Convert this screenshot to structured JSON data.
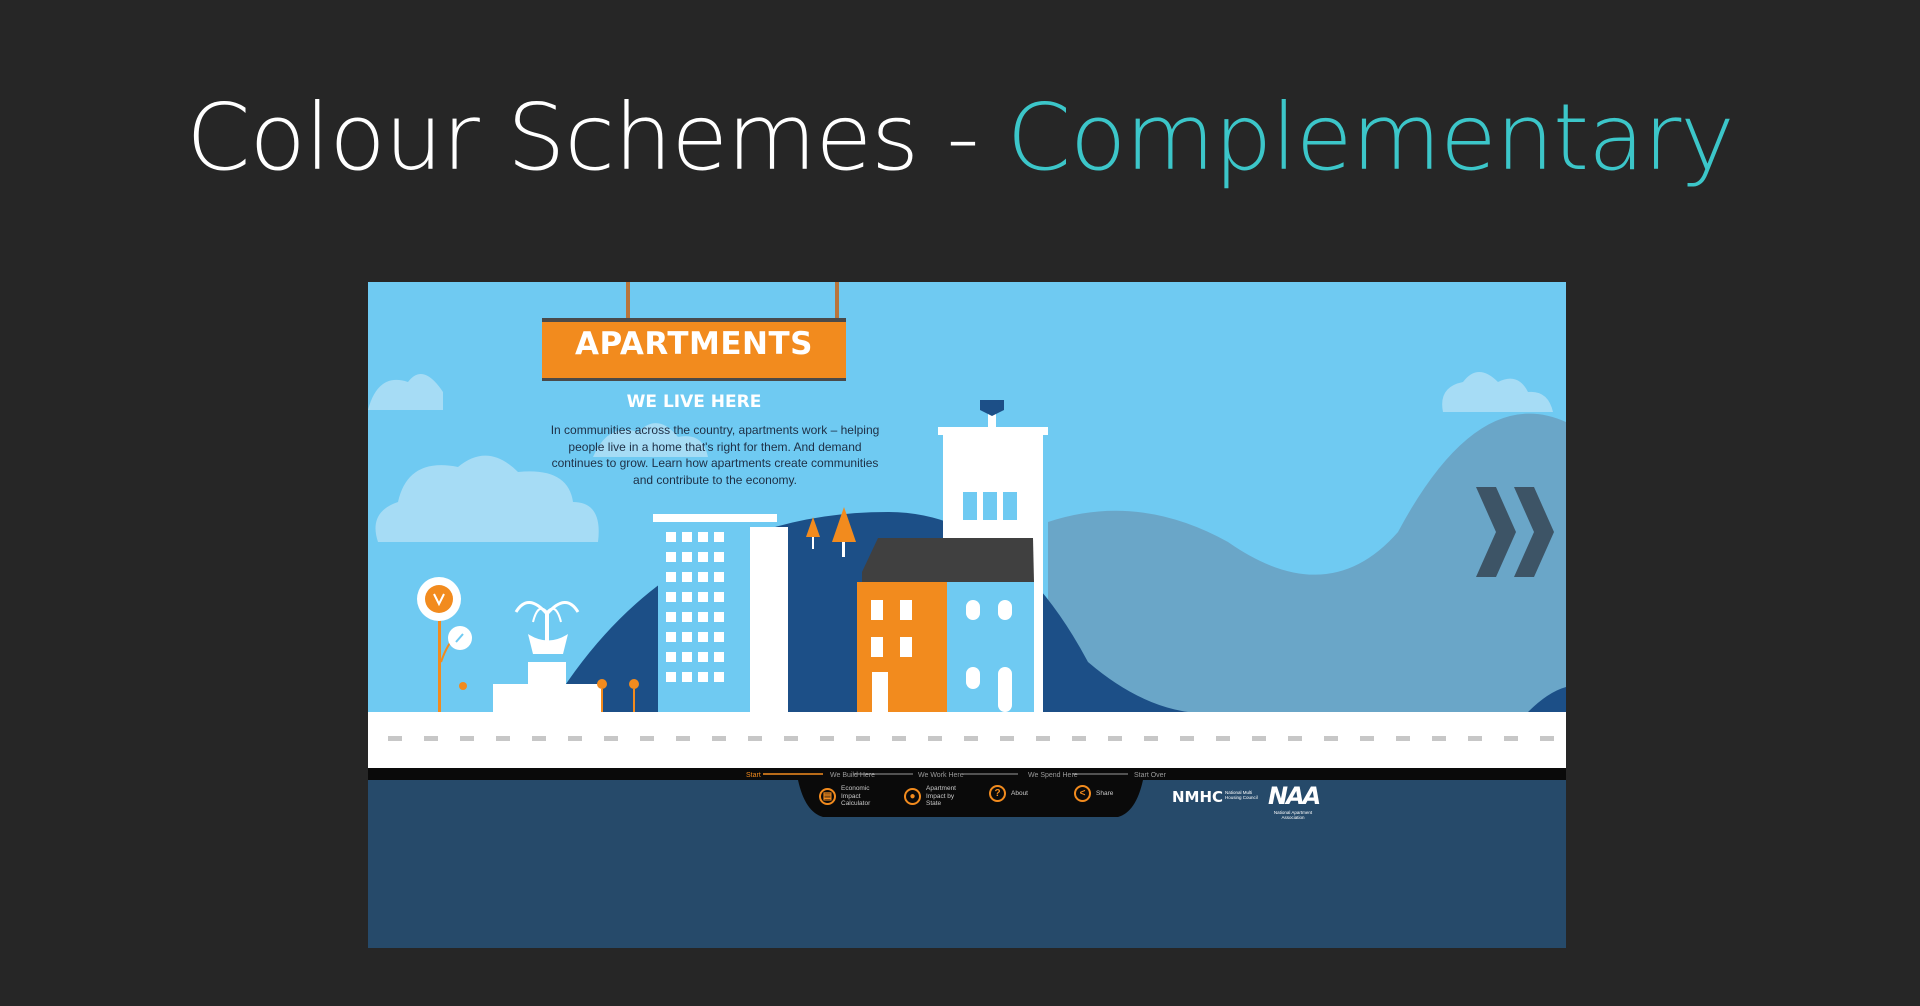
{
  "slide": {
    "title_main": "Colour Schemes - ",
    "title_accent": "Complementary",
    "accent_color": "#3cc6c9"
  },
  "apartments_site": {
    "sign_title": "APARTMENTS",
    "sign_subtitle": "WE LIVE HERE",
    "intro_text": "In communities across the country, apartments work – helping people live in a home that's right for them. And demand continues to grow. Learn how apartments create communities and contribute to the economy.",
    "next_icon": "double-chevron-right-icon",
    "progress_steps": [
      {
        "label": "Start"
      },
      {
        "label": "We Build Here"
      },
      {
        "label": "We Work Here"
      },
      {
        "label": "We Spend Here"
      },
      {
        "label": "Start Over"
      }
    ],
    "toolbar": [
      {
        "label": "Economic Impact Calculator",
        "icon": "calculator-icon"
      },
      {
        "label": "Apartment Impact by State",
        "icon": "us-map-icon"
      },
      {
        "label": "About",
        "icon": "question-icon"
      },
      {
        "label": "Share",
        "icon": "share-icon"
      }
    ],
    "logos": {
      "nmhc": "NMHC",
      "nmhc_full": "National Multi Housing Council",
      "naa": "NAA",
      "naa_full": "National Apartment Association"
    },
    "colors": {
      "sky": "#6fcaf2",
      "hill_dark": "#1c4f87",
      "hill_mid": "#6aa6c8",
      "orange": "#f28b1e",
      "footer": "#264a6a"
    }
  }
}
